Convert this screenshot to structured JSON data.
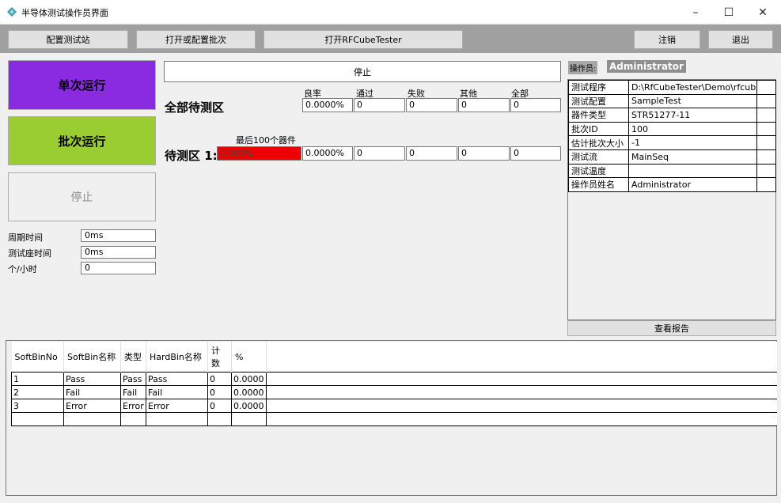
{
  "window": {
    "title": "半导体测试操作员界面",
    "minimize": "–",
    "maximize": "☐",
    "close": "✕",
    "icon_color": "#3a9bb5"
  },
  "toolbar": {
    "configure_station": "配置测试站",
    "open_config_lot": "打开或配置批次",
    "open_rfcubetester": "打开RFCubeTester",
    "logout": "注销",
    "exit": "退出"
  },
  "controls": {
    "single_run": "单次运行",
    "single_run_color": "#8a2be2",
    "batch_run": "批次运行",
    "batch_run_color": "#9acd32",
    "stop": "停止"
  },
  "timing": {
    "cycle_time_label": "周期时间",
    "cycle_time_value": "0ms",
    "socket_time_label": "测试座时间",
    "socket_time_value": "0ms",
    "per_hour_label": "个/小时",
    "per_hour_value": "0"
  },
  "status": {
    "stop_bar": "停止",
    "headers": {
      "yield": "良率",
      "pass": "通过",
      "fail": "失败",
      "other": "其他",
      "total": "全部"
    },
    "all_zone": {
      "title": "全部待测区",
      "yield": "0.0000%",
      "pass": "0",
      "fail": "0",
      "other": "0",
      "total": "0"
    },
    "last100_label": "最后100个器件",
    "zone1": {
      "title": "待测区 1:",
      "bar_text": "0.000%",
      "yield": "0.0000%",
      "pass": "0",
      "fail": "0",
      "other": "0",
      "total": "0"
    }
  },
  "operator": {
    "label": "操作员:",
    "name": "Administrator"
  },
  "info": [
    {
      "key": "测试程序",
      "value": "D:\\RfCubeTester\\Demo\\rfcub"
    },
    {
      "key": "测试配置",
      "value": "SampleTest"
    },
    {
      "key": "器件类型",
      "value": "STR51277-11"
    },
    {
      "key": "批次ID",
      "value": "100"
    },
    {
      "key": "估计批次大小",
      "value": "-1"
    },
    {
      "key": "测试流",
      "value": "MainSeq"
    },
    {
      "key": "测试温度",
      "value": ""
    },
    {
      "key": "操作员姓名",
      "value": "Administrator"
    }
  ],
  "view_report": "查看报告",
  "bins": {
    "headers": [
      "SoftBinNo",
      "SoftBin名称",
      "类型",
      "HardBin名称",
      "计数",
      "%"
    ],
    "rows": [
      [
        "1",
        "Pass",
        "Pass",
        "Pass",
        "0",
        "0.0000"
      ],
      [
        "2",
        "Fail",
        "Fail",
        "Fail",
        "0",
        "0.0000"
      ],
      [
        "3",
        "Error",
        "Error",
        "Error",
        "0",
        "0.0000"
      ],
      [
        "",
        "",
        "",
        "",
        "",
        ""
      ]
    ]
  }
}
